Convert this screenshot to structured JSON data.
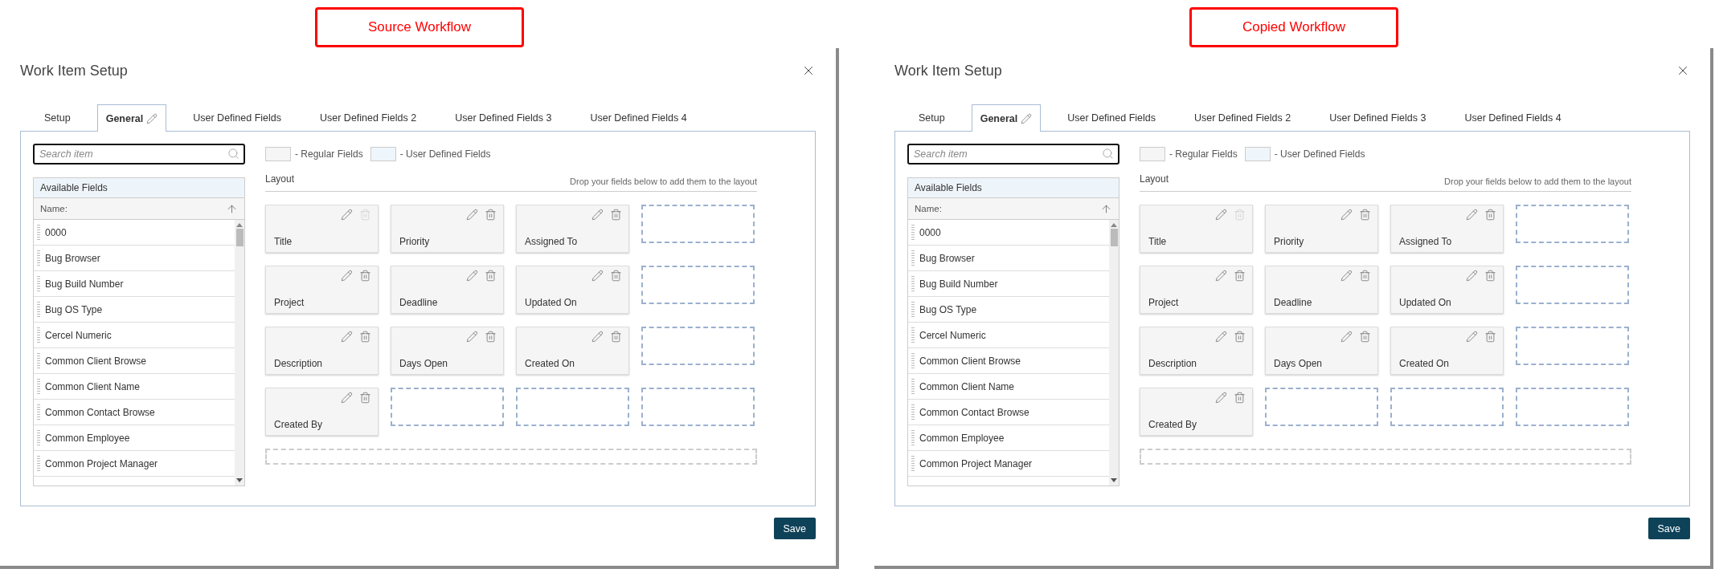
{
  "panels": [
    {
      "label": "Source Workflow",
      "dialog": {
        "title": "Work Item Setup",
        "tabs": [
          {
            "label": "Setup",
            "selected": false,
            "editable": false
          },
          {
            "label": "General",
            "selected": true,
            "editable": true
          },
          {
            "label": "User Defined Fields",
            "selected": false,
            "editable": false
          },
          {
            "label": "User Defined Fields 2",
            "selected": false,
            "editable": false
          },
          {
            "label": "User Defined Fields 3",
            "selected": false,
            "editable": false
          },
          {
            "label": "User Defined Fields 4",
            "selected": false,
            "editable": false
          }
        ],
        "search": {
          "placeholder": "Search item"
        },
        "legend": [
          {
            "kind": "regular",
            "label": "- Regular Fields"
          },
          {
            "kind": "user",
            "label": "- User Defined Fields"
          }
        ],
        "available_fields": {
          "title": "Available Fields",
          "column": "Name:",
          "items": [
            "0000",
            "Bug Browser",
            "Bug Build Number",
            "Bug OS Type",
            "Cercel Numeric",
            "Common Client Browse",
            "Common Client Name",
            "Common Contact Browse",
            "Common Employee",
            "Common Project Manager"
          ]
        },
        "layout": {
          "title": "Layout",
          "hint": "Drop your fields below to add them to the layout",
          "rows": [
            [
              {
                "kind": "field",
                "label": "Title",
                "delete_disabled": true
              },
              {
                "kind": "field",
                "label": "Priority",
                "delete_disabled": false
              },
              {
                "kind": "field",
                "label": "Assigned To",
                "delete_disabled": false
              },
              {
                "kind": "empty"
              }
            ],
            [
              {
                "kind": "field",
                "label": "Project",
                "delete_disabled": false
              },
              {
                "kind": "field",
                "label": "Deadline",
                "delete_disabled": false
              },
              {
                "kind": "field",
                "label": "Updated On",
                "delete_disabled": false
              },
              {
                "kind": "empty"
              }
            ],
            [
              {
                "kind": "field",
                "label": "Description",
                "delete_disabled": false
              },
              {
                "kind": "field",
                "label": "Days Open",
                "delete_disabled": false
              },
              {
                "kind": "field",
                "label": "Created On",
                "delete_disabled": false
              },
              {
                "kind": "empty"
              }
            ],
            [
              {
                "kind": "field",
                "label": "Created By",
                "delete_disabled": false
              },
              {
                "kind": "empty"
              },
              {
                "kind": "empty"
              },
              {
                "kind": "empty"
              }
            ]
          ]
        },
        "save": "Save"
      }
    },
    {
      "label": "Copied Workflow",
      "dialog": {
        "title": "Work Item Setup",
        "tabs": [
          {
            "label": "Setup",
            "selected": false,
            "editable": false
          },
          {
            "label": "General",
            "selected": true,
            "editable": true
          },
          {
            "label": "User Defined Fields",
            "selected": false,
            "editable": false
          },
          {
            "label": "User Defined Fields 2",
            "selected": false,
            "editable": false
          },
          {
            "label": "User Defined Fields 3",
            "selected": false,
            "editable": false
          },
          {
            "label": "User Defined Fields 4",
            "selected": false,
            "editable": false
          }
        ],
        "search": {
          "placeholder": "Search item"
        },
        "legend": [
          {
            "kind": "regular",
            "label": "- Regular Fields"
          },
          {
            "kind": "user",
            "label": "- User Defined Fields"
          }
        ],
        "available_fields": {
          "title": "Available Fields",
          "column": "Name:",
          "items": [
            "0000",
            "Bug Browser",
            "Bug Build Number",
            "Bug OS Type",
            "Cercel Numeric",
            "Common Client Browse",
            "Common Client Name",
            "Common Contact Browse",
            "Common Employee",
            "Common Project Manager"
          ]
        },
        "layout": {
          "title": "Layout",
          "hint": "Drop your fields below to add them to the layout",
          "rows": [
            [
              {
                "kind": "field",
                "label": "Title",
                "delete_disabled": true
              },
              {
                "kind": "field",
                "label": "Priority",
                "delete_disabled": false
              },
              {
                "kind": "field",
                "label": "Assigned To",
                "delete_disabled": false
              },
              {
                "kind": "empty"
              }
            ],
            [
              {
                "kind": "field",
                "label": "Project",
                "delete_disabled": false
              },
              {
                "kind": "field",
                "label": "Deadline",
                "delete_disabled": false
              },
              {
                "kind": "field",
                "label": "Updated On",
                "delete_disabled": false
              },
              {
                "kind": "empty"
              }
            ],
            [
              {
                "kind": "field",
                "label": "Description",
                "delete_disabled": false
              },
              {
                "kind": "field",
                "label": "Days Open",
                "delete_disabled": false
              },
              {
                "kind": "field",
                "label": "Created On",
                "delete_disabled": false
              },
              {
                "kind": "empty"
              }
            ],
            [
              {
                "kind": "field",
                "label": "Created By",
                "delete_disabled": false
              },
              {
                "kind": "empty"
              },
              {
                "kind": "empty"
              },
              {
                "kind": "empty"
              }
            ]
          ]
        },
        "save": "Save"
      }
    }
  ]
}
